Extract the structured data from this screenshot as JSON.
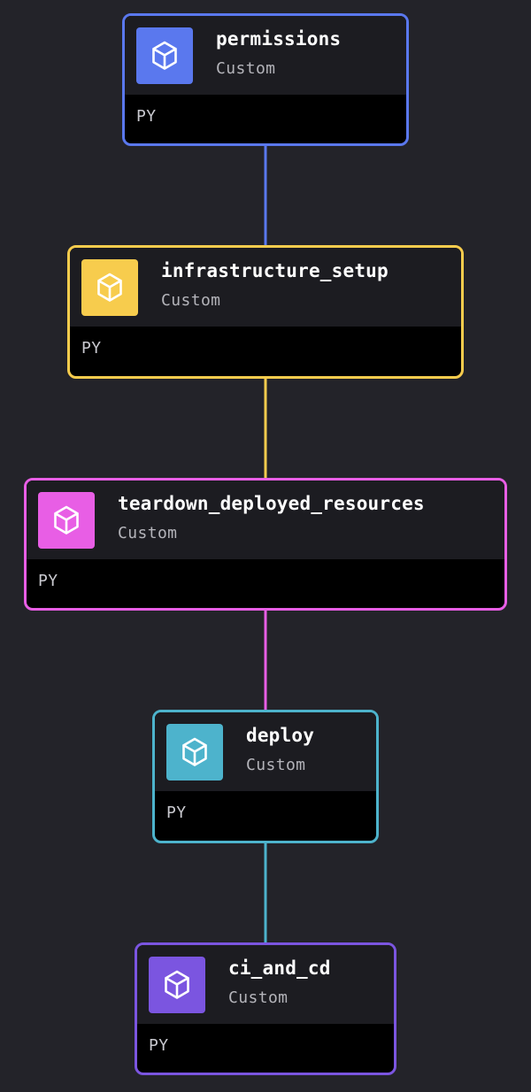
{
  "nodes": [
    {
      "id": "permissions",
      "title": "permissions",
      "subtitle": "Custom",
      "language": "PY",
      "color": "#5a78ee",
      "icon": "cube-icon"
    },
    {
      "id": "infrastructure_setup",
      "title": "infrastructure_setup",
      "subtitle": "Custom",
      "language": "PY",
      "color": "#f7cc4d",
      "icon": "cube-icon"
    },
    {
      "id": "teardown_deployed_resources",
      "title": "teardown_deployed_resources",
      "subtitle": "Custom",
      "language": "PY",
      "color": "#e85ee5",
      "icon": "cube-icon"
    },
    {
      "id": "deploy",
      "title": "deploy",
      "subtitle": "Custom",
      "language": "PY",
      "color": "#4db3cc",
      "icon": "cube-icon"
    },
    {
      "id": "ci_and_cd",
      "title": "ci_and_cd",
      "subtitle": "Custom",
      "language": "PY",
      "color": "#7b55e0",
      "icon": "cube-icon"
    }
  ],
  "edges": [
    {
      "from": "permissions",
      "to": "infrastructure_setup",
      "color": "#5a78ee"
    },
    {
      "from": "infrastructure_setup",
      "to": "teardown_deployed_resources",
      "color": "#f7cc4d"
    },
    {
      "from": "teardown_deployed_resources",
      "to": "deploy",
      "color": "#e85ee5"
    },
    {
      "from": "deploy",
      "to": "ci_and_cd",
      "color": "#4db3cc"
    }
  ]
}
